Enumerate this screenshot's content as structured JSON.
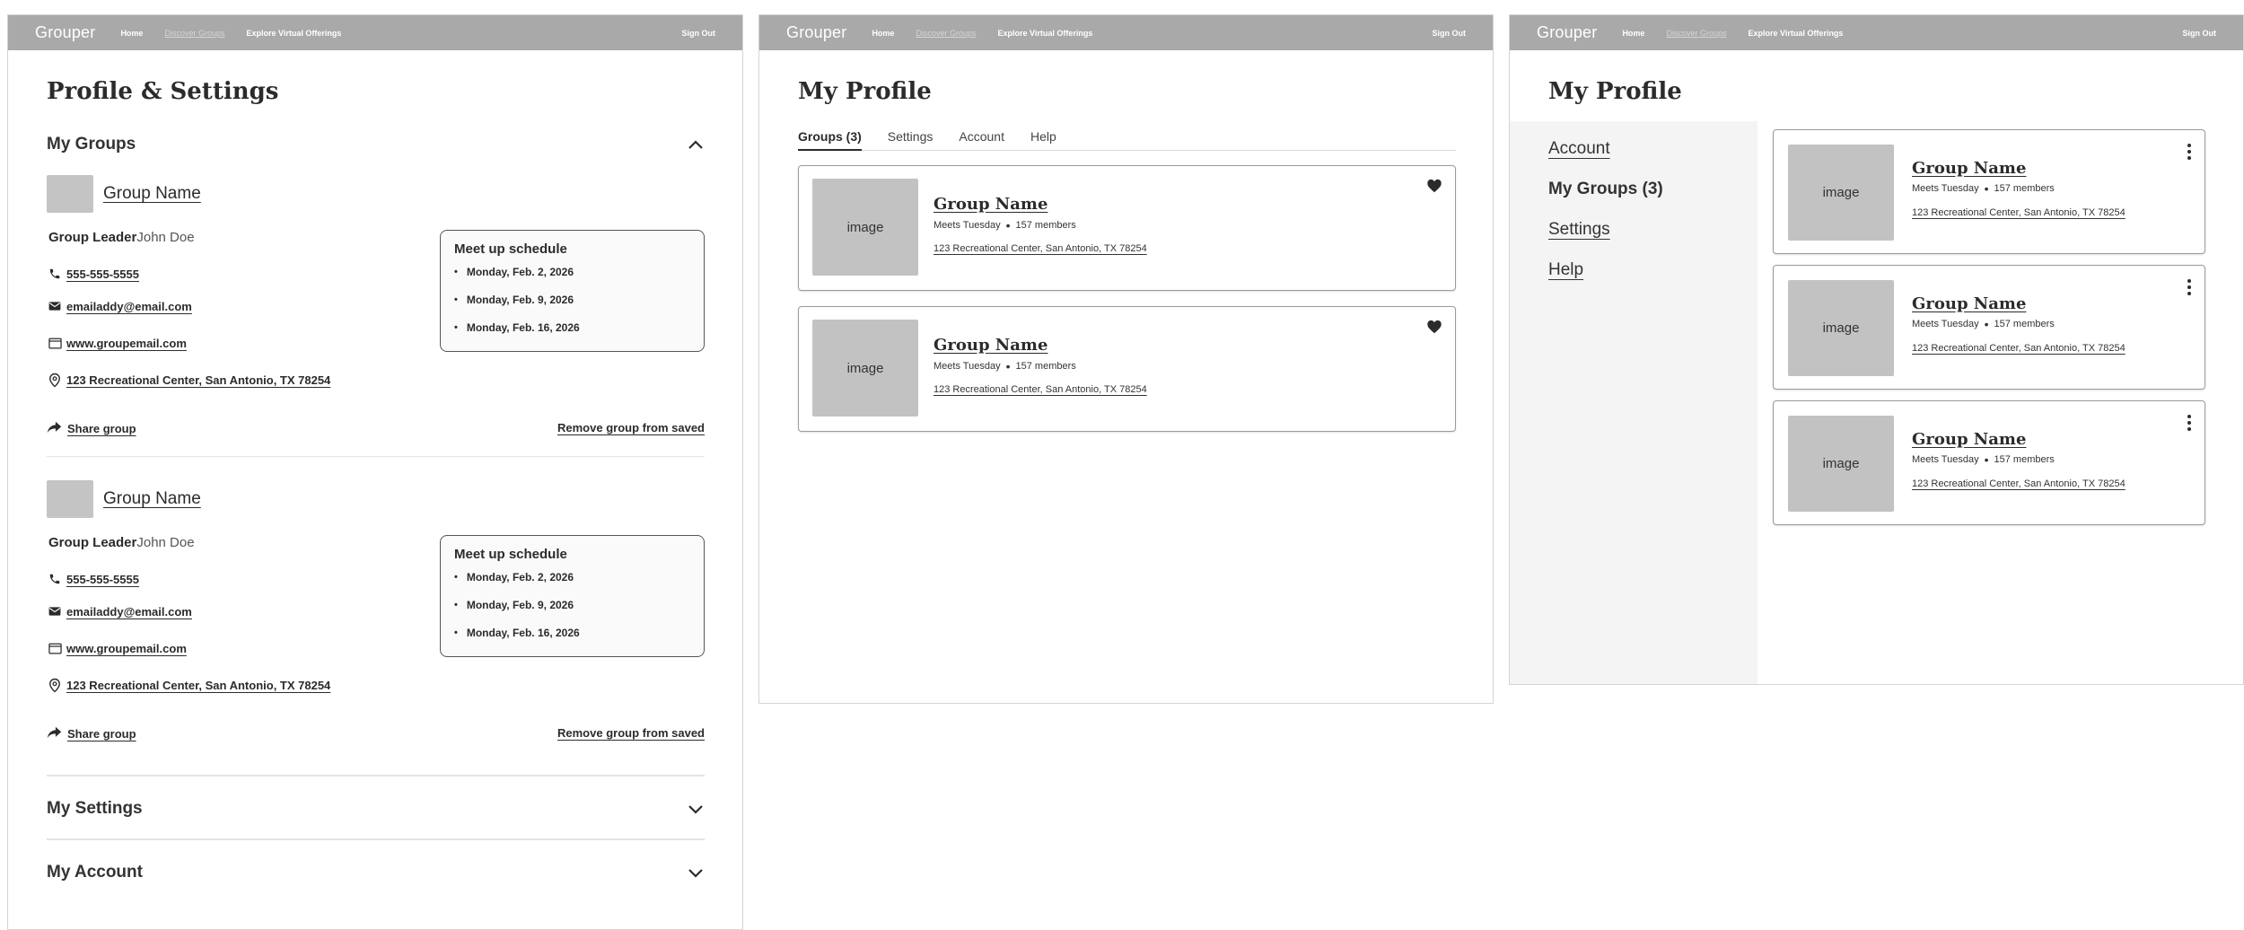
{
  "nav": {
    "logo": "Grouper",
    "home": "Home",
    "discover": "Discover Groups",
    "explore": "Explore Virtual Offerings",
    "signout": "Sign Out"
  },
  "frame1": {
    "title": "Profile & Settings",
    "my_groups": "My Groups",
    "my_settings": "My Settings",
    "my_account": "My Account",
    "groups": [
      {
        "name": "Group Name",
        "leader_label": "Group Leader",
        "leader_name": "John Doe",
        "phone": "555-555-5555",
        "email": "emailaddy@email.com",
        "website": "www.groupemail.com",
        "address": "123 Recreational Center, San Antonio, TX 78254",
        "schedule_title": "Meet up schedule",
        "schedule": [
          "Monday, Feb. 2, 2026",
          "Monday, Feb. 9, 2026",
          "Monday, Feb. 16, 2026"
        ],
        "share": "Share group",
        "remove": "Remove group from saved"
      },
      {
        "name": "Group Name",
        "leader_label": "Group Leader",
        "leader_name": "John Doe",
        "phone": "555-555-5555",
        "email": "emailaddy@email.com",
        "website": "www.groupemail.com",
        "address": "123 Recreational Center, San Antonio, TX 78254",
        "schedule_title": "Meet up schedule",
        "schedule": [
          "Monday, Feb. 2, 2026",
          "Monday, Feb. 9, 2026",
          "Monday, Feb. 16, 2026"
        ],
        "share": "Share group",
        "remove": "Remove group from saved"
      }
    ]
  },
  "frame2": {
    "title": "My Profile",
    "tabs": [
      "Groups (3)",
      "Settings",
      "Account",
      "Help"
    ],
    "active_tab": "Groups (3)",
    "cards": [
      {
        "image": "image",
        "name": "Group Name",
        "meets": "Meets Tuesday",
        "members": "157 members",
        "address": "123 Recreational Center, San Antonio, TX 78254"
      },
      {
        "image": "image",
        "name": "Group Name",
        "meets": "Meets Tuesday",
        "members": "157 members",
        "address": "123 Recreational Center, San Antonio, TX 78254"
      }
    ]
  },
  "frame3": {
    "title": "My Profile",
    "side_items": [
      "Account",
      "My Groups (3)",
      "Settings",
      "Help"
    ],
    "active_side": "My Groups (3)",
    "cards": [
      {
        "image": "image",
        "name": "Group Name",
        "meets": "Meets Tuesday",
        "members": "157 members",
        "address": "123 Recreational Center, San Antonio, TX 78254"
      },
      {
        "image": "image",
        "name": "Group Name",
        "meets": "Meets Tuesday",
        "members": "157 members",
        "address": "123 Recreational Center, San Antonio, TX 78254"
      },
      {
        "image": "image",
        "name": "Group Name",
        "meets": "Meets Tuesday",
        "members": "157 members",
        "address": "123 Recreational Center, San Antonio, TX 78254"
      }
    ]
  },
  "icons": {
    "phone": "phone-icon",
    "email": "mail-icon",
    "website": "browser-window-icon",
    "address": "location-pin-icon",
    "share": "share-arrow-icon",
    "chevron_up": "chevron-up-icon",
    "chevron_down": "chevron-down-icon",
    "heart": "heart-icon",
    "kebab": "more-vertical-icon"
  },
  "colors": {
    "nav_bg": "#a9a9a9",
    "placeholder": "#c2c2c2",
    "text": "#2b2b2b",
    "sidebar_bg": "#f4f4f4"
  }
}
